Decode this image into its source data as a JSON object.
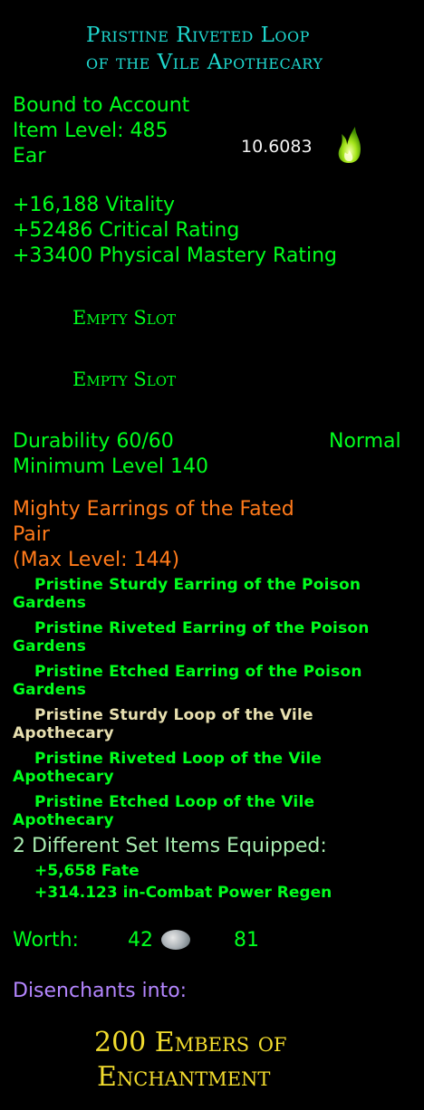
{
  "item": {
    "title_line1": "Pristine Riveted Loop",
    "title_line2": "of the Vile Apothecary",
    "binding": "Bound to Account",
    "item_level": "Item Level: 485",
    "slot_type": "Ear",
    "dps_value": "10.6083",
    "dps_icon": "green-flame-icon",
    "stats": [
      "+16,188 Vitality",
      "+52486 Critical Rating",
      "+33400 Physical Mastery Rating"
    ],
    "empty_slots": [
      "Empty Slot",
      "Empty Slot"
    ],
    "durability": "Durability 60/60",
    "durability_state": "Normal",
    "min_level": "Minimum Level 140"
  },
  "set": {
    "name_line1": "Mighty Earrings of the Fated",
    "name_line2": "Pair",
    "max_level": "(Max Level: 144)",
    "items": [
      {
        "l1": "Pristine Sturdy Earring of the Poison",
        "l2": "Gardens",
        "equipped": true
      },
      {
        "l1": "Pristine Riveted Earring of the Poison",
        "l2": "Gardens",
        "equipped": true
      },
      {
        "l1": "Pristine Etched Earring of the Poison",
        "l2": "Gardens",
        "equipped": true
      },
      {
        "l1": "Pristine Sturdy Loop of the Vile",
        "l2": "Apothecary",
        "equipped": false
      },
      {
        "l1": "Pristine Riveted Loop of the Vile",
        "l2": "Apothecary",
        "equipped": true
      },
      {
        "l1": "Pristine Etched Loop of the Vile",
        "l2": "Apothecary",
        "equipped": true
      }
    ],
    "equipped_summary": "2 Different Set Items Equipped:",
    "bonuses": [
      "+5,658 Fate",
      "+314.123 in-Combat Power Regen"
    ]
  },
  "worth": {
    "label": "Worth:",
    "silver": "42",
    "coin_icon": "silver-coin-icon",
    "copper": "81"
  },
  "disenchant": {
    "label": "Disenchants into:",
    "result_line1": "200 Embers of",
    "result_line2": "Enchantment"
  },
  "colors": {
    "title": "#1fd8cf",
    "stat_green": "#00ff1e",
    "set_orange": "#ff7a1a",
    "unequipped": "#e8e0b0",
    "summary": "#a9ecb0",
    "disenchant": "#b486ff",
    "ember_gold": "#f2dc2e"
  }
}
